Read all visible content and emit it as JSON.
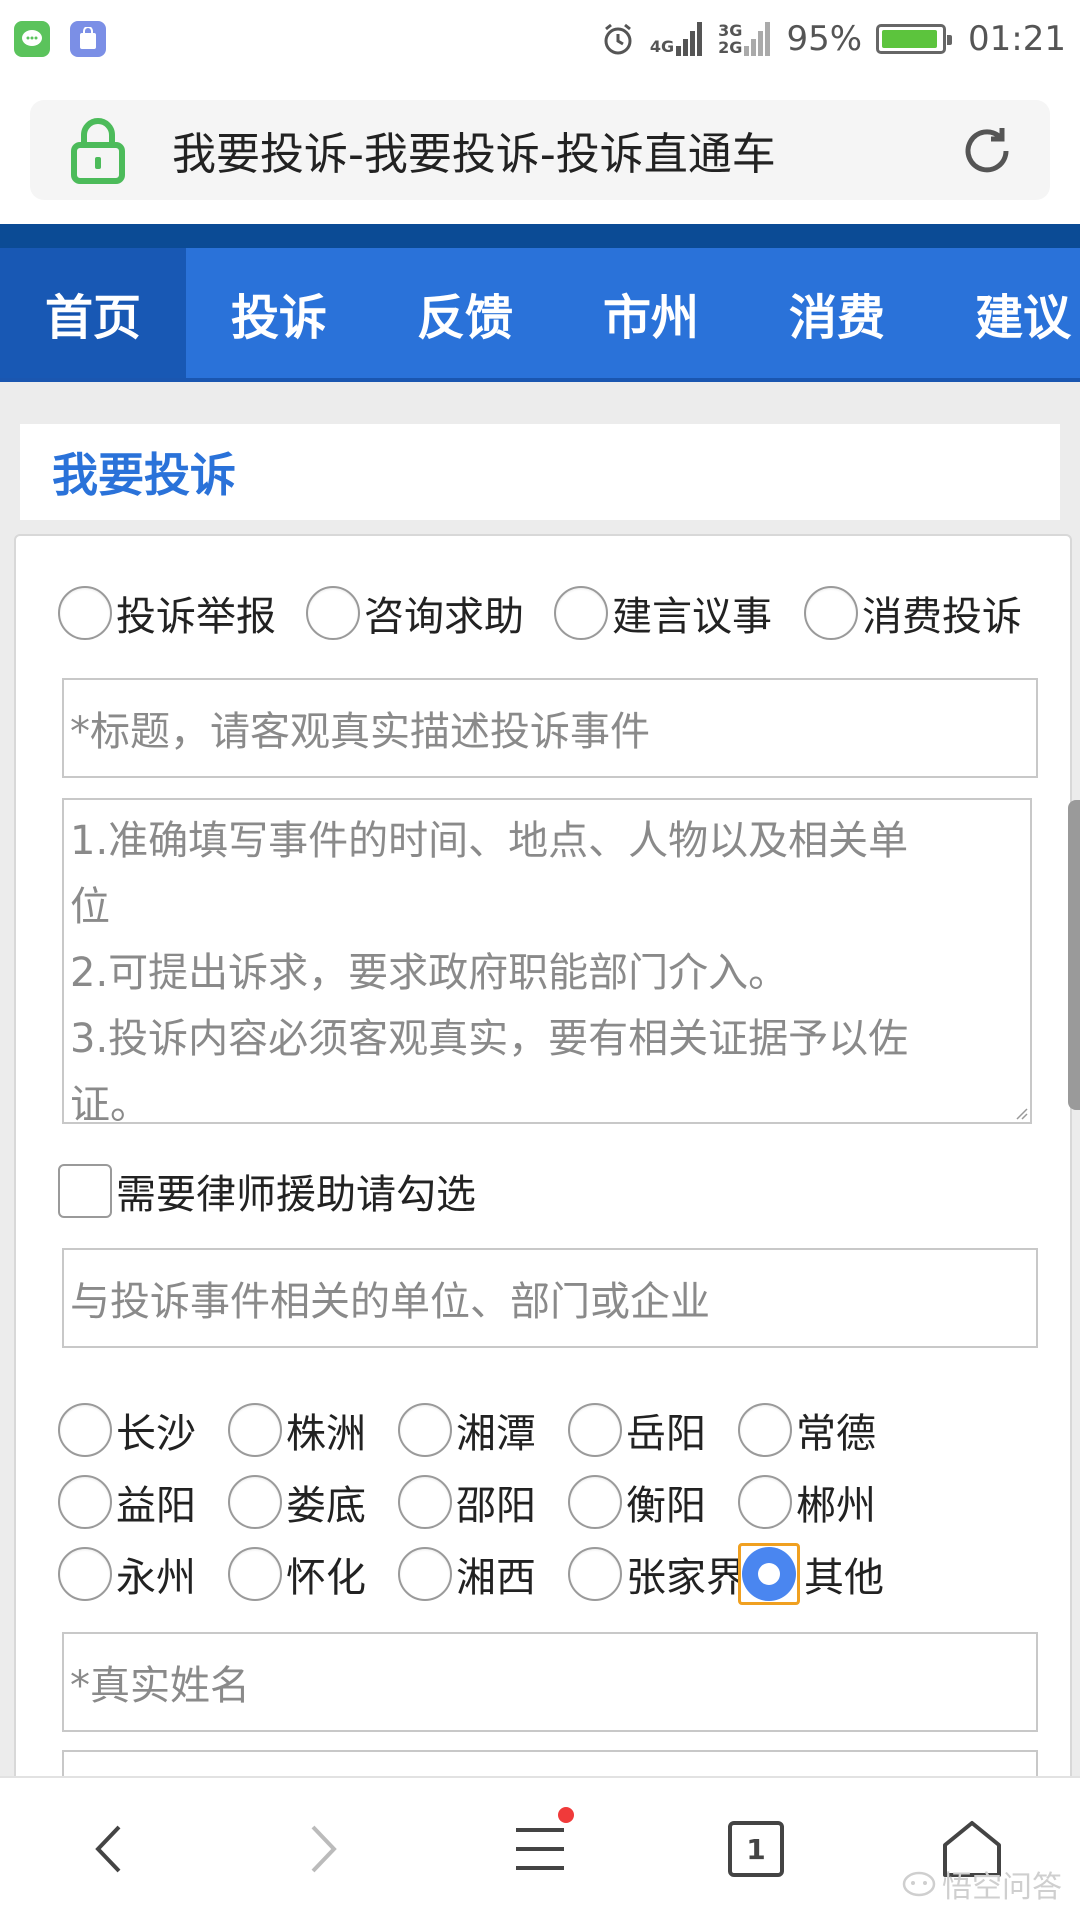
{
  "status_bar": {
    "network_1": "4G",
    "network_2": "3G",
    "network_3": "2G",
    "battery_text": "95%",
    "battery_level": 0.95,
    "time": "01:21"
  },
  "url_bar": {
    "title": "我要投诉-我要投诉-投诉直通车"
  },
  "nav": {
    "items": [
      {
        "label": "首页"
      },
      {
        "label": "投诉"
      },
      {
        "label": "反馈"
      },
      {
        "label": "市州"
      },
      {
        "label": "消费"
      },
      {
        "label": "建议"
      }
    ]
  },
  "section": {
    "title": "我要投诉"
  },
  "form": {
    "types": [
      {
        "label": "投诉举报"
      },
      {
        "label": "咨询求助"
      },
      {
        "label": "建言议事"
      },
      {
        "label": "消费投诉"
      }
    ],
    "title_placeholder": "*标题，请客观真实描述投诉事件",
    "content_placeholder_lines": [
      "1.准确填写事件的时间、地点、人物以及相关单",
      "位",
      "2.可提出诉求，要求政府职能部门介入。",
      "3.投诉内容必须客观真实，要有相关证据予以佐",
      "证。"
    ],
    "lawyer_label": "需要律师援助请勾选",
    "unit_placeholder": "与投诉事件相关的单位、部门或企业",
    "cities": [
      [
        "长沙",
        "株洲",
        "湘潭",
        "岳阳",
        "常德"
      ],
      [
        "益阳",
        "娄底",
        "邵阳",
        "衡阳",
        "郴州"
      ],
      [
        "永州",
        "怀化",
        "湘西",
        "张家界",
        "其他"
      ]
    ],
    "selected_city": "其他",
    "name_placeholder": "*真实姓名"
  },
  "toolbar": {
    "tabs_count": "1",
    "watermark": "悟空问答"
  },
  "colors": {
    "nav_bg": "#2a72d9",
    "nav_active": "#1858b4",
    "accent": "#2a72d9",
    "selected_radio": "#4a86f0",
    "focus_outline": "#f0a020",
    "badge": "#f03a3a"
  }
}
